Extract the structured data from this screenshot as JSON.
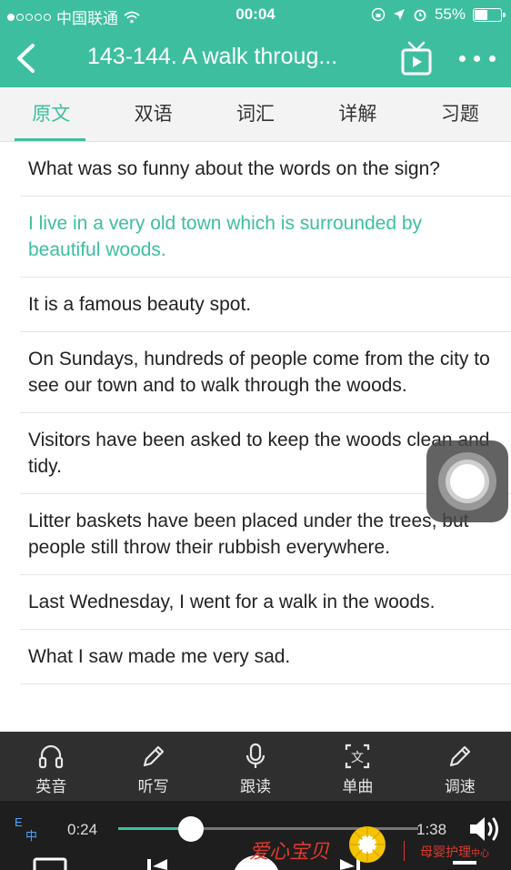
{
  "status_bar": {
    "carrier": "中国联通",
    "time": "00:04",
    "battery": "55%",
    "battery_level": 0.55
  },
  "nav": {
    "title": "143-144. A walk throug..."
  },
  "tabs": [
    {
      "label": "原文",
      "active": true
    },
    {
      "label": "双语",
      "active": false
    },
    {
      "label": "词汇",
      "active": false
    },
    {
      "label": "详解",
      "active": false
    },
    {
      "label": "习题",
      "active": false
    }
  ],
  "sentences": [
    {
      "text": "What was so funny about the words on the sign?",
      "active": false
    },
    {
      "text": "I live in a very old town which is surrounded by beautiful woods.",
      "active": true
    },
    {
      "text": "It is a famous beauty spot.",
      "active": false
    },
    {
      "text": "On Sundays, hundreds of people come from the city to see our town and to walk through the woods.",
      "active": false
    },
    {
      "text": "Visitors have been asked to keep the woods clean and tidy.",
      "active": false
    },
    {
      "text": "Litter baskets have been placed under the trees, but people still throw their rubbish everywhere.",
      "active": false
    },
    {
      "text": "Last Wednesday, I went for a walk in the woods.",
      "active": false
    },
    {
      "text": "What I saw made me very sad.",
      "active": false
    }
  ],
  "toolbar": {
    "items": [
      {
        "label": "英音",
        "icon": "headphones-icon"
      },
      {
        "label": "听写",
        "icon": "pencil-icon"
      },
      {
        "label": "跟读",
        "icon": "microphone-icon"
      },
      {
        "label": "单曲",
        "icon": "document-icon"
      },
      {
        "label": "调速",
        "icon": "pencil-icon"
      }
    ]
  },
  "player": {
    "lang_toggle_top": "E",
    "lang_toggle_bottom": "中",
    "current_time": "0:24",
    "total_time": "1:38",
    "progress": 0.245
  },
  "watermark": {
    "left_text": "爱心宝贝",
    "right_text": "母婴护理",
    "right_small": "中心"
  },
  "colors": {
    "accent": "#3dbf9f",
    "toolbar_bg": "#2f2f2f",
    "player_bg": "#1e1e1e"
  }
}
